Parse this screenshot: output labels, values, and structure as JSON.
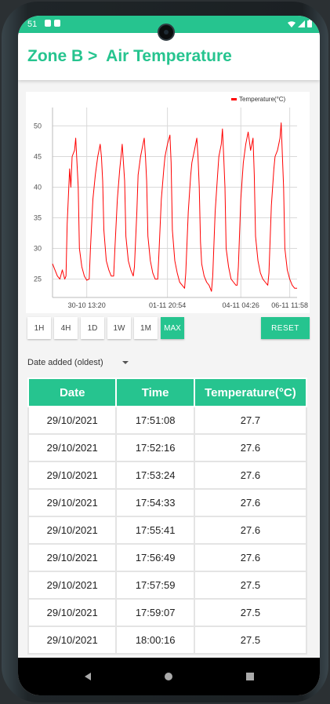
{
  "status_bar": {
    "time": "51"
  },
  "header": {
    "title": "Zone B >  Air Temperature"
  },
  "chart_data": {
    "type": "line",
    "title": "",
    "legend": "Temperature(°C)",
    "legend_position": "top-right",
    "grid": true,
    "ylim": [
      22,
      53
    ],
    "xlim": [
      0,
      100
    ],
    "y_ticks": [
      25,
      30,
      35,
      40,
      45,
      50
    ],
    "x_tick_labels": [
      {
        "x": 14,
        "label": "30-10 13:20"
      },
      {
        "x": 47,
        "label": "01-11 20:54"
      },
      {
        "x": 77,
        "label": "04-11 04:26"
      },
      {
        "x": 97,
        "label": "06-11 11:58"
      }
    ],
    "series": [
      {
        "name": "Temperature(°C)",
        "color": "#ff0000",
        "points": [
          [
            0,
            27.5
          ],
          [
            1,
            26.5
          ],
          [
            2,
            25.5
          ],
          [
            3,
            25
          ],
          [
            4,
            26.5
          ],
          [
            5,
            25
          ],
          [
            5.5,
            25.5
          ],
          [
            6,
            34
          ],
          [
            7,
            43
          ],
          [
            7.5,
            40
          ],
          [
            8,
            45
          ],
          [
            9,
            46
          ],
          [
            9.5,
            48
          ],
          [
            10,
            44
          ],
          [
            10.5,
            40
          ],
          [
            11,
            30
          ],
          [
            12,
            27
          ],
          [
            13,
            25.5
          ],
          [
            14,
            24.8
          ],
          [
            15,
            25
          ],
          [
            15.5,
            30
          ],
          [
            16.5,
            38
          ],
          [
            17.5,
            42
          ],
          [
            18.5,
            45
          ],
          [
            19,
            46
          ],
          [
            19.5,
            47
          ],
          [
            20,
            45
          ],
          [
            20.5,
            41
          ],
          [
            21,
            33
          ],
          [
            22,
            28
          ],
          [
            23,
            26.5
          ],
          [
            24,
            25.5
          ],
          [
            25,
            25.5
          ],
          [
            25.5,
            30
          ],
          [
            26.5,
            38
          ],
          [
            27.5,
            43
          ],
          [
            28,
            45
          ],
          [
            28.5,
            47
          ],
          [
            29,
            44
          ],
          [
            29.5,
            41
          ],
          [
            30,
            32
          ],
          [
            31,
            28
          ],
          [
            32,
            26.5
          ],
          [
            33,
            25.5
          ],
          [
            33.5,
            27
          ],
          [
            34.5,
            36
          ],
          [
            35,
            42
          ],
          [
            36,
            45
          ],
          [
            37,
            47
          ],
          [
            37.5,
            48
          ],
          [
            38,
            45
          ],
          [
            38.5,
            41
          ],
          [
            39,
            32
          ],
          [
            40,
            28
          ],
          [
            41,
            26
          ],
          [
            42,
            25
          ],
          [
            43,
            25
          ],
          [
            43.5,
            29
          ],
          [
            44.5,
            38
          ],
          [
            45.5,
            43
          ],
          [
            46,
            45
          ],
          [
            47,
            47
          ],
          [
            48,
            48.5
          ],
          [
            48.5,
            44
          ],
          [
            49,
            33
          ],
          [
            50,
            28
          ],
          [
            51,
            26
          ],
          [
            52,
            24.5
          ],
          [
            53,
            24
          ],
          [
            54,
            23.5
          ],
          [
            54.5,
            26
          ],
          [
            55.5,
            36
          ],
          [
            56.5,
            42
          ],
          [
            57,
            44
          ],
          [
            58,
            46
          ],
          [
            59,
            48
          ],
          [
            59.5,
            45
          ],
          [
            60,
            40
          ],
          [
            60.5,
            31
          ],
          [
            61,
            27.5
          ],
          [
            62,
            25.5
          ],
          [
            63,
            24.5
          ],
          [
            64,
            24
          ],
          [
            65,
            23
          ],
          [
            65.5,
            25.5
          ],
          [
            66.5,
            36
          ],
          [
            67.5,
            42
          ],
          [
            68,
            45
          ],
          [
            69,
            47
          ],
          [
            69.5,
            49.5
          ],
          [
            70,
            45
          ],
          [
            70.5,
            40
          ],
          [
            71,
            30
          ],
          [
            72,
            27
          ],
          [
            73,
            25
          ],
          [
            74,
            24.5
          ],
          [
            75,
            24
          ],
          [
            75.5,
            24
          ],
          [
            76,
            27
          ],
          [
            77,
            38
          ],
          [
            78,
            44
          ],
          [
            79,
            47
          ],
          [
            80,
            49
          ],
          [
            81,
            46
          ],
          [
            82,
            48
          ],
          [
            82.5,
            42
          ],
          [
            83,
            32
          ],
          [
            84,
            28
          ],
          [
            85,
            26
          ],
          [
            86,
            25
          ],
          [
            87,
            24.5
          ],
          [
            88,
            24
          ],
          [
            88.5,
            26
          ],
          [
            89.5,
            37
          ],
          [
            90.5,
            43
          ],
          [
            91,
            45
          ],
          [
            92,
            46
          ],
          [
            93,
            48
          ],
          [
            93.5,
            50.5
          ],
          [
            94,
            45
          ],
          [
            94.5,
            40
          ],
          [
            95,
            30
          ],
          [
            96,
            26.5
          ],
          [
            97,
            25
          ],
          [
            98,
            24
          ],
          [
            99,
            23.5
          ],
          [
            100,
            23.5
          ]
        ]
      }
    ]
  },
  "range_buttons": [
    "1H",
    "4H",
    "1D",
    "1W",
    "1M",
    "MAX"
  ],
  "active_range": "MAX",
  "reset_label": "RESET",
  "sort": {
    "selected": "Date added (oldest)"
  },
  "table": {
    "headers": [
      "Date",
      "Time",
      "Temperature(°C)"
    ],
    "rows": [
      [
        "29/10/2021",
        "17:51:08",
        "27.7"
      ],
      [
        "29/10/2021",
        "17:52:16",
        "27.6"
      ],
      [
        "29/10/2021",
        "17:53:24",
        "27.6"
      ],
      [
        "29/10/2021",
        "17:54:33",
        "27.6"
      ],
      [
        "29/10/2021",
        "17:55:41",
        "27.6"
      ],
      [
        "29/10/2021",
        "17:56:49",
        "27.6"
      ],
      [
        "29/10/2021",
        "17:57:59",
        "27.5"
      ],
      [
        "29/10/2021",
        "17:59:07",
        "27.5"
      ],
      [
        "29/10/2021",
        "18:00:16",
        "27.5"
      ]
    ]
  },
  "colors": {
    "accent": "#26c48f",
    "series": "#ff0000"
  }
}
